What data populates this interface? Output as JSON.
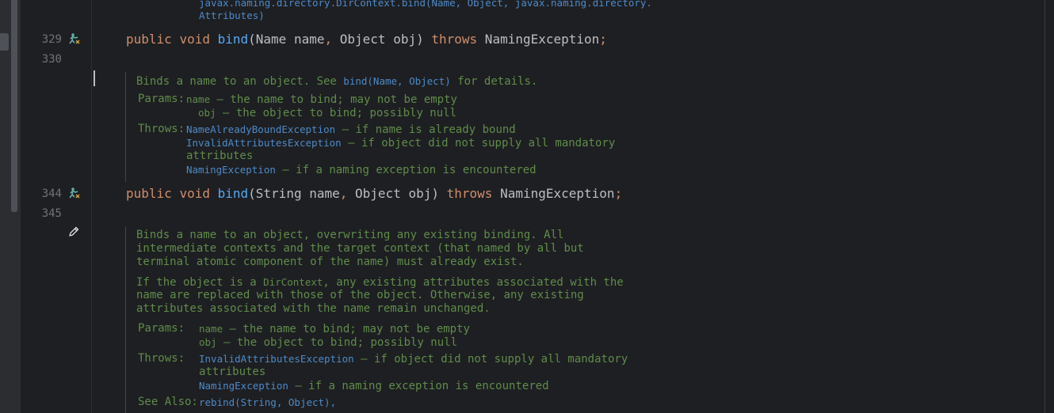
{
  "top_fragment": {
    "line1": "javax.naming.directory.DirContext.bind(Name, Object, javax.naming.directory.",
    "line2": "Attributes)"
  },
  "line_numbers": {
    "l329": "329",
    "l330": "330",
    "l344": "344",
    "l345": "345"
  },
  "code": {
    "m1": {
      "kw1": "public",
      "kw2": "void",
      "name": "bind",
      "paren_open": "(",
      "p1_type": "Name",
      "p1_name": " name",
      "comma": ",",
      "p2": " Object obj",
      "paren_close": ")",
      "throws": "throws",
      "exc": " NamingException",
      "semi": ";"
    },
    "m2": {
      "kw1": "public",
      "kw2": "void",
      "name": "bind",
      "paren_open": "(",
      "p1_type": "String",
      "p1_name": " name",
      "comma": ",",
      "p2": " Object obj",
      "paren_close": ")",
      "throws": "throws",
      "exc": " NamingException",
      "semi": ";"
    }
  },
  "doc1": {
    "summary_prefix": "Binds a name to an object. See ",
    "summary_link": "bind(Name, Object)",
    "summary_suffix": " for details.",
    "params_label": "Params:",
    "param1_name": "name",
    "param1_desc": " – the name to bind; may not be empty",
    "param2_name": "obj",
    "param2_desc": " – the object to bind; possibly null",
    "throws_label": "Throws:",
    "throw1_name": "NameAlreadyBoundException",
    "throw1_desc": " – if name is already bound",
    "throw2_name": "InvalidAttributesException",
    "throw2_desc": " – if object did not supply all mandatory",
    "throw2_cont": "attributes",
    "throw3_name": "NamingException",
    "throw3_desc": " – if a naming exception is encountered"
  },
  "doc2": {
    "p1_l1": "Binds a name to an object, overwriting any existing binding. All",
    "p1_l2": "intermediate contexts and the target context (that named by all but",
    "p1_l3": "terminal atomic component of the name) must already exist.",
    "p2_l1_prefix": "If the object is a ",
    "p2_l1_code": "DirContext",
    "p2_l1_suffix": ", any existing attributes associated with the",
    "p2_l2": "name are replaced with those of the object. Otherwise, any existing",
    "p2_l3": "attributes associated with the name remain unchanged.",
    "params_label": "Params:",
    "param1_name": "name",
    "param1_desc": " – the name to bind; may not be empty",
    "param2_name": "obj",
    "param2_desc": " – the object to bind; possibly null",
    "throws_label": "Throws:",
    "throw1_name": "InvalidAttributesException",
    "throw1_desc": " – if object did not supply all mandatory",
    "throw1_cont": "attributes",
    "throw2_name": "NamingException",
    "throw2_desc": " – if a naming exception is encountered",
    "see_also_label": "See Also:",
    "see_also_1": "rebind(String, Object),"
  },
  "icons": {
    "override": "implements-method-icon",
    "edit": "pencil-icon"
  },
  "colors": {
    "keyword": "#cf8e6d",
    "function": "#56a8f5",
    "doc_text": "#5f8c4a",
    "doc_link": "#4c8ac9",
    "background": "#1e1f22"
  }
}
